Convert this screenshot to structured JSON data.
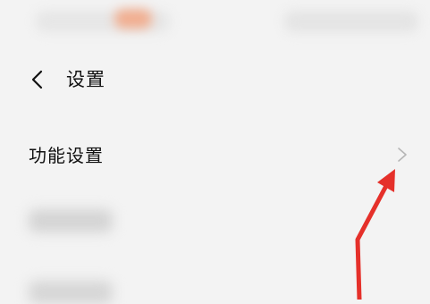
{
  "header": {
    "title": "设置",
    "back_icon": "chevron-left-icon"
  },
  "settings_list": {
    "items": [
      {
        "label": "功能设置",
        "icon": "chevron-right-icon"
      }
    ]
  },
  "colors": {
    "background": "#f3f3f3",
    "text": "#111111",
    "chevron": "#b5b5b5",
    "annotation_arrow": "#e5302a",
    "status_accent": "#f4a07a"
  }
}
